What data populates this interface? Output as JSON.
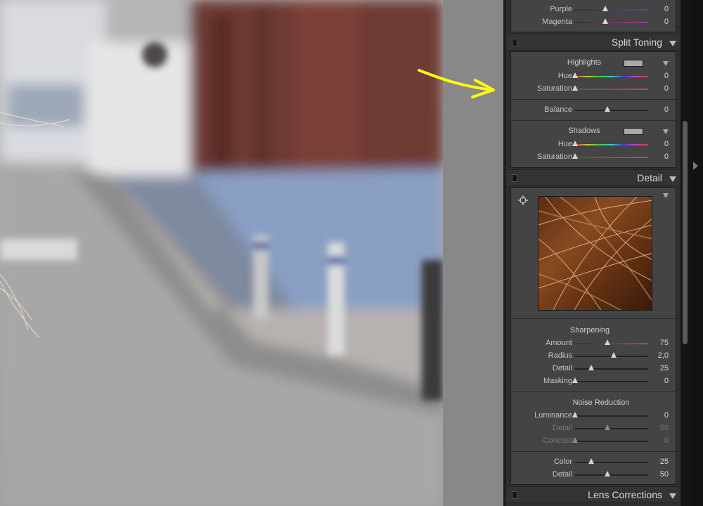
{
  "colors": {
    "panel_bg": "#444444",
    "header_bg": "#333333",
    "annotation_arrow": "#ffff00",
    "hair_preview": "#8a4a20"
  },
  "hsl_tail": {
    "rows": [
      {
        "label": "Purple",
        "value": "0"
      },
      {
        "label": "Magenta",
        "value": "0"
      }
    ]
  },
  "split_toning": {
    "title": "Split Toning",
    "highlights": {
      "label": "Highlights",
      "hue": {
        "label": "Hue",
        "value": "0"
      },
      "saturation": {
        "label": "Saturation",
        "value": "0"
      }
    },
    "balance": {
      "label": "Balance",
      "value": "0"
    },
    "shadows": {
      "label": "Shadows",
      "hue": {
        "label": "Hue",
        "value": "0"
      },
      "saturation": {
        "label": "Saturation",
        "value": "0"
      }
    }
  },
  "detail": {
    "title": "Detail",
    "preview_icon": "target-icon",
    "sharpening": {
      "label": "Sharpening",
      "amount": {
        "label": "Amount",
        "value": "75"
      },
      "radius": {
        "label": "Radius",
        "value": "2,0"
      },
      "detail": {
        "label": "Detail",
        "value": "25"
      },
      "masking": {
        "label": "Masking",
        "value": "0"
      }
    },
    "noise_reduction": {
      "label": "Noise Reduction",
      "luminance": {
        "label": "Luminance",
        "value": "0"
      },
      "lum_detail": {
        "label": "Detail",
        "value": "50"
      },
      "contrast": {
        "label": "Contrast",
        "value": "0"
      },
      "color": {
        "label": "Color",
        "value": "25"
      },
      "color_detail": {
        "label": "Detail",
        "value": "50"
      }
    }
  },
  "lens_corrections": {
    "title": "Lens Corrections"
  }
}
